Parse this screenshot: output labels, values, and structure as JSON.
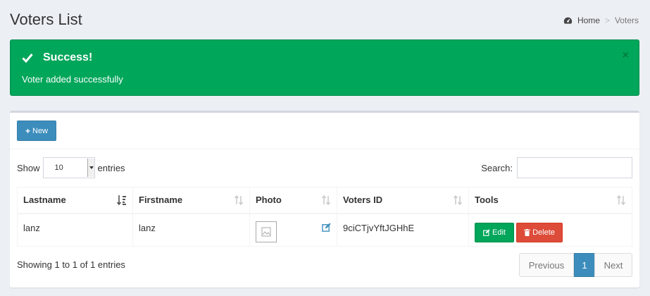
{
  "page": {
    "title": "Voters List"
  },
  "breadcrumb": {
    "home": "Home",
    "separator": ">",
    "current": "Voters"
  },
  "alert": {
    "title": "Success!",
    "message": "Voter added successfully",
    "close": "×"
  },
  "toolbar": {
    "new_label": "New"
  },
  "table_controls": {
    "show_label": "Show",
    "entries_value": "10",
    "entries_label": "entries",
    "search_label": "Search:",
    "search_value": ""
  },
  "table": {
    "columns": [
      "Lastname",
      "Firstname",
      "Photo",
      "Voters ID",
      "Tools"
    ],
    "rows": [
      {
        "lastname": "lanz",
        "firstname": "lanz",
        "voters_id": "9ciCTjvYftJGHhE",
        "edit_label": "Edit",
        "delete_label": "Delete"
      }
    ]
  },
  "footer": {
    "info": "Showing 1 to 1 of 1 entries",
    "previous": "Previous",
    "page": "1",
    "next": "Next"
  },
  "colors": {
    "success": "#00a65a",
    "primary": "#3c8dbc",
    "danger": "#dd4b39"
  }
}
